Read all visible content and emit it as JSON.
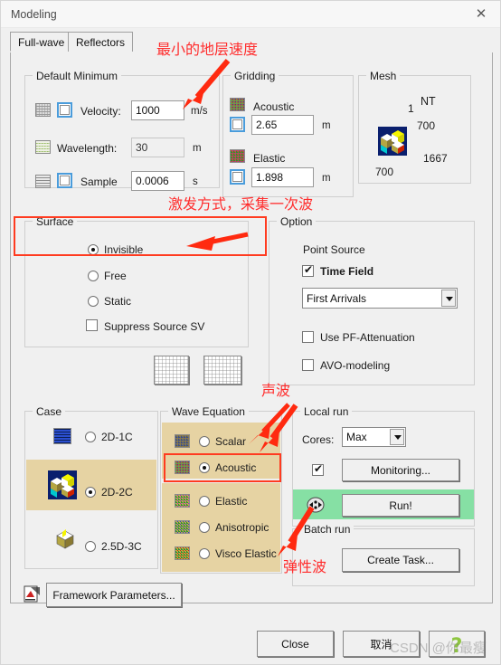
{
  "window": {
    "title": "Modeling",
    "close_icon": "close-x-icon"
  },
  "tabs": [
    {
      "label": "Full-wave",
      "selected": true
    },
    {
      "label": "Reflectors",
      "selected": false
    }
  ],
  "default_minimum": {
    "legend": "Default Minimum",
    "velocity": {
      "label": "Velocity:",
      "value": "1000",
      "unit": "m/s",
      "checked": false,
      "icon": "grid-chart-icon"
    },
    "wavelength": {
      "label": "Wavelength:",
      "value": "30",
      "unit": "m",
      "icon": "wave-icon"
    },
    "sample": {
      "label": "Sample",
      "value": "0.0006",
      "unit": "s",
      "checked": false,
      "icon": "lines-icon"
    }
  },
  "gridding": {
    "legend": "Gridding",
    "acoustic": {
      "label": "Acoustic",
      "value": "2.65",
      "unit": "m",
      "checked": false,
      "icon": "noise-acoustic-icon"
    },
    "elastic": {
      "label": "Elastic",
      "value": "1.898",
      "unit": "m",
      "checked": false,
      "icon": "noise-elastic-icon"
    }
  },
  "mesh": {
    "legend": "Mesh",
    "nt_label": "NT",
    "n1": "1",
    "nt_value": "700",
    "dim_right": "1667",
    "dim_bottom": "700",
    "icon": "cube-3d-icon"
  },
  "surface": {
    "legend": "Surface",
    "options": [
      {
        "label": "Invisible",
        "selected": true
      },
      {
        "label": "Free",
        "selected": false
      },
      {
        "label": "Static",
        "selected": false
      }
    ],
    "suppress": {
      "label": "Suppress Source SV",
      "checked": false
    }
  },
  "option": {
    "legend": "Option",
    "point_source_label": "Point Source",
    "time_field": {
      "label": "Time Field",
      "checked": true
    },
    "arrivals_select": {
      "value": "First Arrivals",
      "options": [
        "First Arrivals"
      ]
    },
    "pf_attenuation": {
      "label": "Use PF-Attenuation",
      "checked": false
    },
    "avo_modeling": {
      "label": "AVO-modeling",
      "checked": false
    }
  },
  "previews": [
    {
      "name": "preview-source-wavefield"
    },
    {
      "name": "preview-raypath"
    }
  ],
  "case": {
    "legend": "Case",
    "options": [
      {
        "label": "2D-1C",
        "selected": false,
        "icon": "wave-1c-icon"
      },
      {
        "label": "2D-2C",
        "selected": true,
        "icon": "cube-2c-icon"
      },
      {
        "label": "2.5D-3C",
        "selected": false,
        "icon": "cube-3c-icon"
      }
    ]
  },
  "wave_equation": {
    "legend": "Wave Equation",
    "group_a": [
      {
        "label": "Scalar",
        "selected": false,
        "icon": "noise-scalar-icon"
      },
      {
        "label": "Acoustic",
        "selected": true,
        "icon": "noise-acoustic2-icon"
      }
    ],
    "group_b": [
      {
        "label": "Elastic",
        "selected": false,
        "icon": "noise-elastic2-icon"
      },
      {
        "label": "Anisotropic",
        "selected": false,
        "icon": "noise-aniso-icon"
      },
      {
        "label": "Visco Elastic",
        "selected": false,
        "icon": "noise-visco-icon"
      }
    ]
  },
  "local_run": {
    "legend": "Local run",
    "cores_label": "Cores:",
    "cores_select": {
      "value": "Max",
      "options": [
        "Max"
      ]
    },
    "monitoring": {
      "label": "Monitoring...",
      "checked": true
    },
    "run": {
      "label": "Run!",
      "icon": "run-mask-icon",
      "highlight_color": "#86e0a4"
    }
  },
  "batch_run": {
    "legend": "Batch run",
    "create_task": {
      "label": "Create Task..."
    }
  },
  "footer": {
    "framework_parameters": {
      "label": "Framework Parameters...",
      "icon": "framework-doc-icon"
    },
    "close": {
      "label": "Close"
    },
    "cancel": {
      "label": "取消"
    },
    "help": {
      "label": "?",
      "icon": "help-question-icon",
      "color": "#8ec640"
    }
  },
  "annotations": [
    {
      "text": "最小的地层速度",
      "name": "annotation-min-velocity"
    },
    {
      "text": "激发方式，采集一次波",
      "name": "annotation-source-mode"
    },
    {
      "text": "声波",
      "name": "annotation-acoustic"
    },
    {
      "text": "弹性波",
      "name": "annotation-elastic"
    }
  ],
  "watermark": {
    "text": "CSDN @你最瘦"
  }
}
